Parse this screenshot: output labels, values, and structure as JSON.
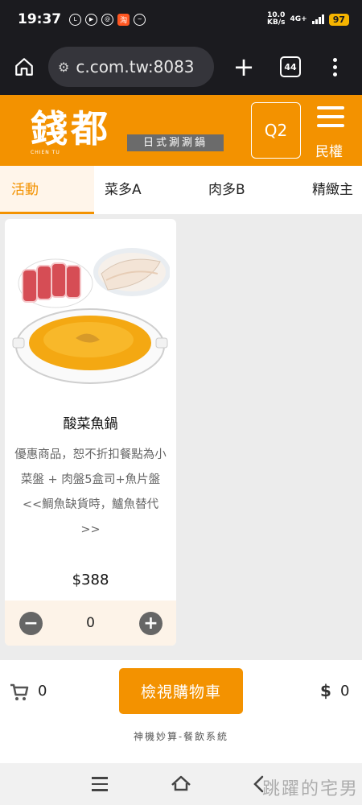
{
  "status_bar": {
    "time": "19:37",
    "app_icons": [
      "line",
      "play",
      "threads",
      "淘",
      "messenger"
    ],
    "net_speed_value": "10.0",
    "net_speed_unit": "KB/s",
    "net_type": "4G+",
    "battery": "97"
  },
  "browser": {
    "url": "c.com.tw:8083",
    "tab_count": "44"
  },
  "header": {
    "logo_text": "錢都",
    "logo_subtext": "CHIEN TU",
    "logo_tagline": "日式涮涮鍋",
    "table_label": "Q2",
    "branch_label": "民權",
    "brand_color": "#f39200"
  },
  "tabs": [
    {
      "label": "活動",
      "active": true
    },
    {
      "label": "菜多A",
      "active": false
    },
    {
      "label": "肉多B",
      "active": false
    },
    {
      "label": "精緻主",
      "active": false
    }
  ],
  "product": {
    "name": "酸菜魚鍋",
    "description": "優惠商品，恕不折扣餐點為小菜盤 + 肉盤5盒司+魚片盤<<鯛魚缺貨時，鱸魚替代>>",
    "price": "$388",
    "quantity": "0"
  },
  "cart": {
    "item_count": "0",
    "button_label": "檢視購物車",
    "currency_symbol": "$",
    "total": "0",
    "footer_text": "神機妙算-餐飲系統"
  },
  "watermark": "跳躍的宅男"
}
